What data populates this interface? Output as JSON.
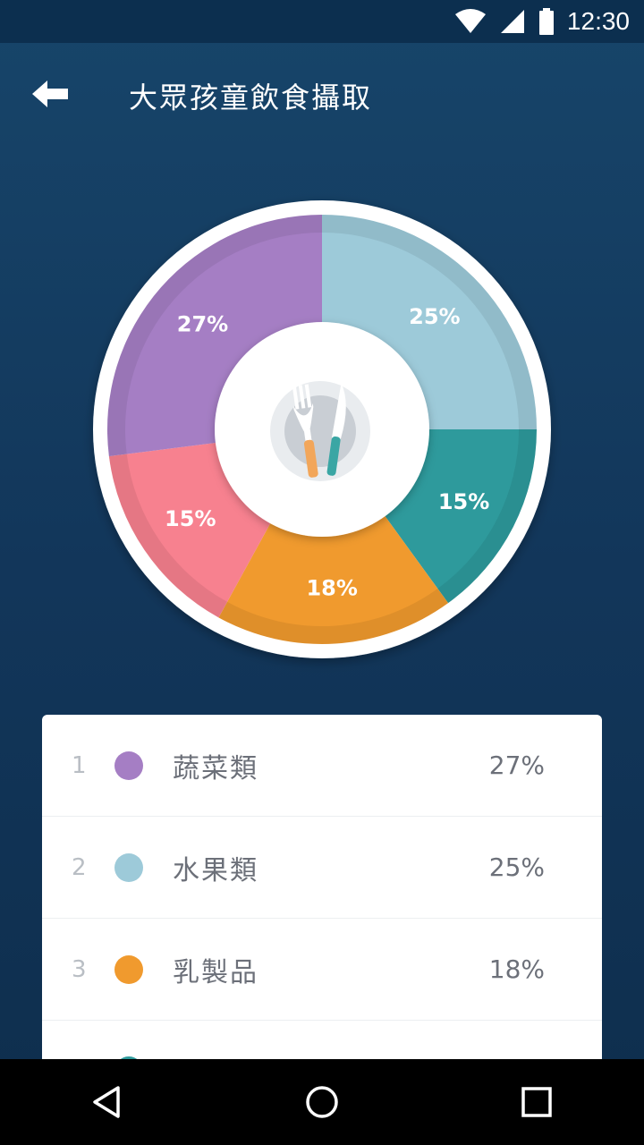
{
  "status_bar": {
    "time": "12:30"
  },
  "app_bar": {
    "title": "大眾孩童飲食攝取"
  },
  "chart_data": {
    "type": "pie",
    "categories": [
      "水果類",
      "",
      "乳製品",
      "",
      "蔬菜類"
    ],
    "values": [
      25,
      15,
      18,
      15,
      27
    ],
    "labels": [
      "25%",
      "15%",
      "18%",
      "15%",
      "27%"
    ],
    "colors": [
      "#9dcad9",
      "#2e9a9c",
      "#f09a2e",
      "#f7818f",
      "#a57ec4"
    ]
  },
  "legend": {
    "items": [
      {
        "index": "1",
        "name": "蔬菜類",
        "percent": "27%",
        "color": "#a57ec4"
      },
      {
        "index": "2",
        "name": "水果類",
        "percent": "25%",
        "color": "#9dcad9"
      },
      {
        "index": "3",
        "name": "乳製品",
        "percent": "18%",
        "color": "#f09a2e"
      },
      {
        "index": "",
        "name": "",
        "percent": "",
        "color": "#2e9a9c"
      }
    ]
  },
  "icons": {
    "back": "arrow-back-icon",
    "center": "plate-fork-knife-icon",
    "wifi": "wifi-icon",
    "signal": "cellular-signal-icon",
    "battery": "battery-icon",
    "nav_back": "nav-back-icon",
    "nav_home": "nav-home-icon",
    "nav_recents": "nav-recents-icon"
  }
}
